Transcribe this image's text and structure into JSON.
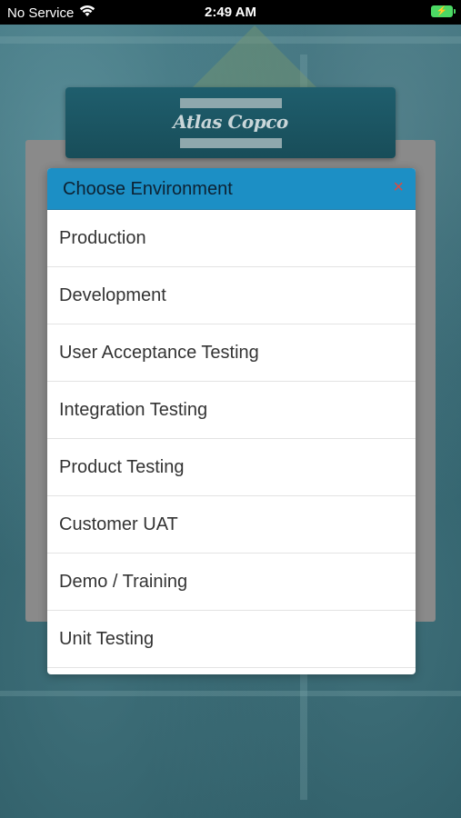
{
  "status_bar": {
    "carrier": "No Service",
    "time": "2:49 AM"
  },
  "logo": {
    "text": "Atlas Copco"
  },
  "modal": {
    "title": "Choose Environment",
    "close_symbol": "×",
    "items": [
      {
        "label": "Production"
      },
      {
        "label": "Development"
      },
      {
        "label": "User Acceptance Testing"
      },
      {
        "label": "Integration Testing"
      },
      {
        "label": "Product Testing"
      },
      {
        "label": "Customer UAT"
      },
      {
        "label": "Demo / Training"
      },
      {
        "label": "Unit Testing"
      }
    ]
  },
  "colors": {
    "header_blue": "#1c8fc5",
    "close_red": "#e04a3f",
    "battery_green": "#4cd964"
  }
}
